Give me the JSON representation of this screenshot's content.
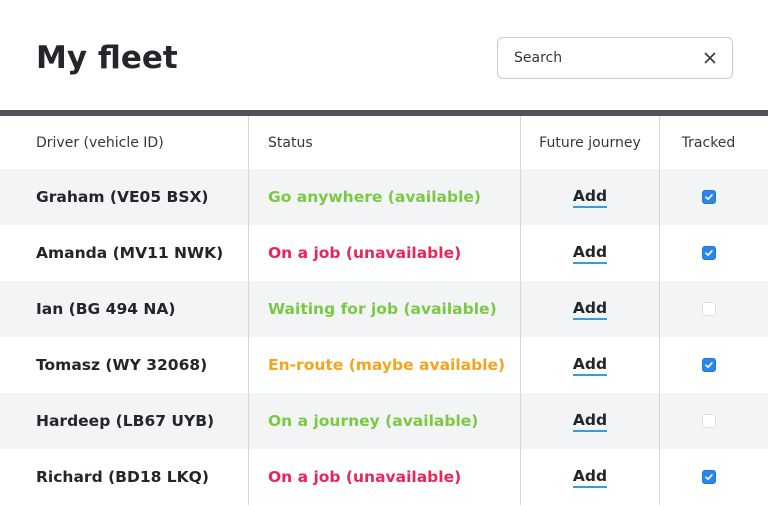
{
  "header": {
    "title": "My fleet",
    "search_placeholder": "Search",
    "clear_icon": "close-icon"
  },
  "colors": {
    "available": "#7ac943",
    "unavailable": "#ee2457",
    "maybe": "#f7a31c",
    "checkbox": "#2b86e8",
    "link_underline": "#3a9bd9"
  },
  "table": {
    "columns": [
      "Driver (vehicle ID)",
      "Status",
      "Future journey",
      "Tracked"
    ],
    "rows": [
      {
        "driver": "Graham (VE05 BSX)",
        "status": "Go anywhere (available)",
        "status_type": "green",
        "action": "Add",
        "tracked": true
      },
      {
        "driver": "Amanda (MV11 NWK)",
        "status": "On a job (unavailable)",
        "status_type": "red",
        "action": "Add",
        "tracked": true
      },
      {
        "driver": "Ian (BG 494 NA)",
        "status": "Waiting for job (available)",
        "status_type": "green",
        "action": "Add",
        "tracked": false
      },
      {
        "driver": "Tomasz (WY 32068)",
        "status": "En-route (maybe available)",
        "status_type": "orange",
        "action": "Add",
        "tracked": true
      },
      {
        "driver": "Hardeep (LB67 UYB)",
        "status": "On a journey (available)",
        "status_type": "green",
        "action": "Add",
        "tracked": false
      },
      {
        "driver": "Richard (BD18 LKQ)",
        "status": "On a job (unavailable)",
        "status_type": "red",
        "action": "Add",
        "tracked": true
      }
    ]
  }
}
